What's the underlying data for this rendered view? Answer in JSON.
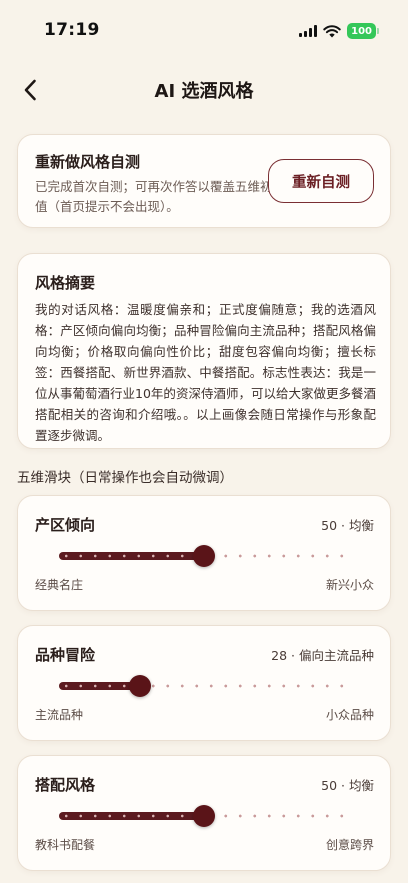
{
  "status": {
    "time": "17:19",
    "battery": "100"
  },
  "header": {
    "title": "AI 选酒风格"
  },
  "reset": {
    "title": "重新做风格自测",
    "desc": "已完成首次自测；可再次作答以覆盖五维初值（首页提示不会出现）。",
    "button": "重新自测"
  },
  "summary": {
    "title": "风格摘要",
    "body": "我的对话风格：温暖度偏亲和；正式度偏随意；我的选酒风格：产区倾向偏向均衡；品种冒险偏向主流品种；搭配风格偏向均衡；价格取向偏向性价比；甜度包容偏向均衡；擅长标签：西餐搭配、新世界酒款、中餐搭配。标志性表达：我是一位从事葡萄酒行业10年的资深侍酒师，可以给大家做更多餐酒搭配相关的咨询和介绍哦。。以上画像会随日常操作与形象配置逐步微调。"
  },
  "sliders_label": "五维滑块（日常操作也会自动微调）",
  "sliders": [
    {
      "name": "产区倾向",
      "value": 50,
      "value_text": "50 · 均衡",
      "min_label": "经典名庄",
      "max_label": "新兴小众"
    },
    {
      "name": "品种冒险",
      "value": 28,
      "value_text": "28 · 偏向主流品种",
      "min_label": "主流品种",
      "max_label": "小众品种"
    },
    {
      "name": "搭配风格",
      "value": 50,
      "value_text": "50 · 均衡",
      "min_label": "教科书配餐",
      "max_label": "创意跨界"
    }
  ],
  "colors": {
    "accent": "#5a1418",
    "background": "#f8f3ea",
    "battery": "#34c759"
  },
  "icons": {
    "back": "chevron-left-icon",
    "wifi": "wifi-icon",
    "signal": "cellular-signal-icon",
    "battery": "battery-icon"
  }
}
